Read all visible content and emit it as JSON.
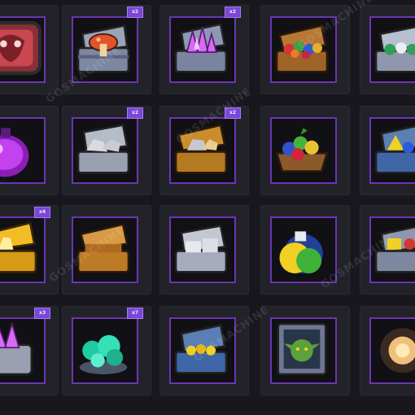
{
  "badges": [
    "x2",
    "x2",
    "x2",
    "x2",
    "x4",
    "x3",
    "x7"
  ],
  "watermark": "GOSMACHINE",
  "items": [
    {
      "icon": "mask-icon"
    },
    {
      "icon": "mushroom-chest-icon"
    },
    {
      "icon": "crystal-chest-icon"
    },
    {
      "icon": "fruit-chest-icon"
    },
    {
      "icon": "gem-chest-icon"
    },
    {
      "icon": "potion-icon"
    },
    {
      "icon": "stone-chest-icon"
    },
    {
      "icon": "ore-chest-icon"
    },
    {
      "icon": "fruit-basket-icon"
    },
    {
      "icon": "gold-gem-chest-icon"
    },
    {
      "icon": "gold-chest-icon"
    },
    {
      "icon": "wood-chest-icon"
    },
    {
      "icon": "stone-block-chest-icon"
    },
    {
      "icon": "potion-flask-icon"
    },
    {
      "icon": "toy-chest-icon"
    },
    {
      "icon": "crystal-crate-icon"
    },
    {
      "icon": "emerald-cluster-icon"
    },
    {
      "icon": "treasure-chest-icon"
    },
    {
      "icon": "goblin-portrait-icon"
    },
    {
      "icon": "dark-orb-icon"
    }
  ],
  "colors": {
    "frame": "#6b35b3",
    "slot": "#222229",
    "background": "#17171d"
  }
}
